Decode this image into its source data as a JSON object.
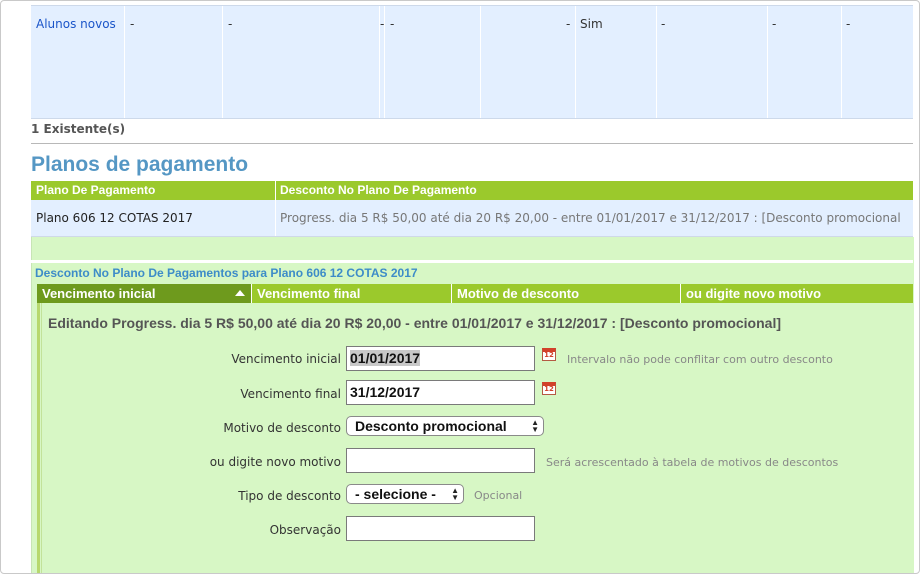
{
  "top_table": {
    "cells": [
      "Alunos novos",
      "-",
      "-",
      "-",
      "-",
      "-",
      "Sim",
      "-",
      "-",
      "-"
    ]
  },
  "existentes": "1 Existente(s)",
  "section_title": "Planos de pagamento",
  "plans": {
    "headers": [
      "Plano De Pagamento",
      "Desconto No Plano De Pagamento"
    ],
    "row": {
      "plan": "Plano 606 12 COTAS 2017",
      "discount": "Progress. dia 5 R$ 50,00 até dia 20 R$ 20,00 - entre 01/01/2017 e 31/12/2017 : [Desconto promocional"
    }
  },
  "discounts": {
    "title": "Desconto No Plano De Pagamentos para Plano 606 12 COTAS 2017",
    "headers": [
      "Vencimento inicial",
      "Vencimento final",
      "Motivo de desconto",
      "ou digite novo motivo"
    ]
  },
  "edit": {
    "title": "Editando Progress. dia 5 R$ 50,00 até dia 20 R$ 20,00 - entre 01/01/2017 e 31/12/2017 : [Desconto promocional]",
    "fields": {
      "vencimento_inicial": {
        "label": "Vencimento inicial",
        "value": "01/01/2017",
        "hint": "Intervalo não pode conflitar com outro desconto"
      },
      "vencimento_final": {
        "label": "Vencimento final",
        "value": "31/12/2017"
      },
      "motivo": {
        "label": "Motivo de desconto",
        "value": "Desconto promocional"
      },
      "novo_motivo": {
        "label": "ou digite novo motivo",
        "value": "",
        "hint": "Será acrescentado à tabela de motivos de descontos"
      },
      "tipo": {
        "label": "Tipo de desconto",
        "value": "- selecione -",
        "hint": "Opcional"
      },
      "observacao": {
        "label": "Observação",
        "value": ""
      }
    },
    "calendar_icon_text": "12"
  },
  "colors": {
    "header_green": "#9bc92c",
    "active_header": "#6e9a1d",
    "panel_green": "#d7f7c5",
    "row_blue": "#e3efff",
    "title_blue": "#5597c4"
  }
}
